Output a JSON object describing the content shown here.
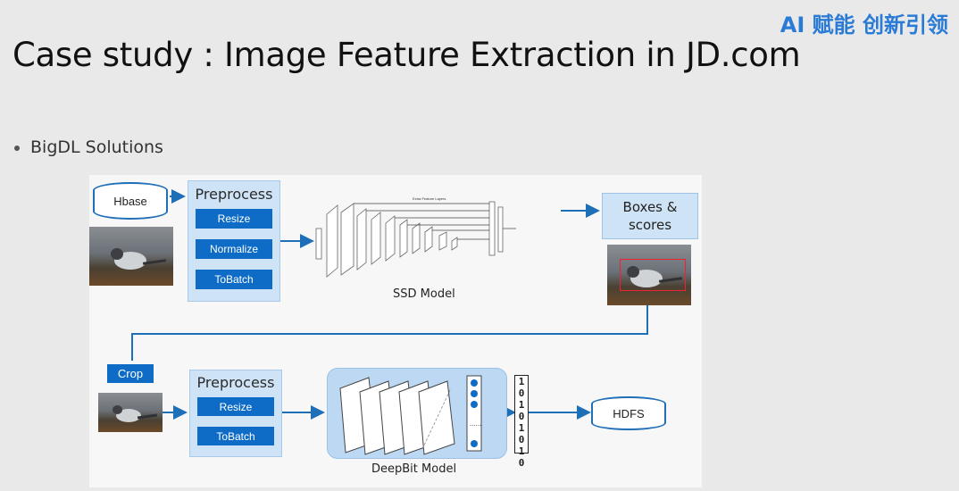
{
  "header": {
    "title": "Case study : Image Feature Extraction in JD.com",
    "brand": "AI 赋能 创新引领"
  },
  "bullet": {
    "text": "BigDL Solutions"
  },
  "diagram": {
    "hbase_label": "Hbase",
    "preprocess_top": {
      "title": "Preprocess",
      "steps": [
        "Resize",
        "Normalize",
        "ToBatch"
      ]
    },
    "ssd_label": "SSD Model",
    "ssd_extra_label": "Extra Feature Layers",
    "boxes_label": "Boxes & scores",
    "crop_label": "Crop",
    "preprocess_bottom": {
      "title": "Preprocess",
      "steps": [
        "Resize",
        "ToBatch"
      ]
    },
    "deepbit_label": "DeepBit Model",
    "bit_digits": [
      "1",
      "0",
      "1",
      "0",
      "1",
      "0",
      "1",
      "0"
    ],
    "hdfs_label": "HDFS",
    "colors": {
      "accent": "#0e6cc6",
      "panel": "#cfe3f6",
      "line": "#1e6fb8"
    }
  }
}
